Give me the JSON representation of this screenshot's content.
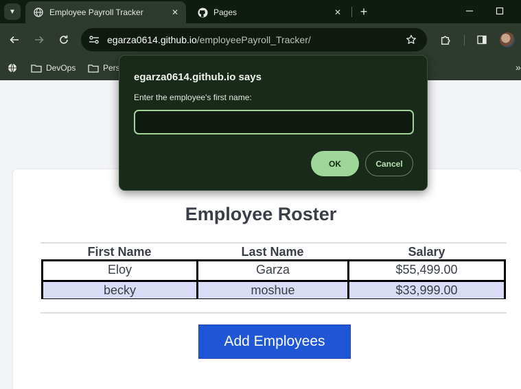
{
  "browser": {
    "tabs": [
      {
        "title": "Employee Payroll Tracker",
        "icon": "globe-icon",
        "active": true
      },
      {
        "title": "Pages",
        "icon": "github-icon",
        "active": false
      }
    ],
    "new_tab": "+",
    "window_controls": {
      "minimize": "—",
      "maximize": "☐",
      "close": "✕"
    },
    "address": {
      "host": "egarza0614.github.io",
      "path": "/employeePayroll_Tracker/"
    },
    "bookmarks": [
      {
        "label": "",
        "icon": "globe-icon"
      },
      {
        "label": "DevOps",
        "icon": "folder-icon"
      },
      {
        "label": "Pers",
        "icon": "folder-icon"
      }
    ],
    "bookmarks_overflow": "»"
  },
  "page": {
    "title": "Employee Roster",
    "columns": [
      "First Name",
      "Last Name",
      "Salary"
    ],
    "rows": [
      {
        "first": "Eloy",
        "last": "Garza",
        "salary": "$55,499.00"
      },
      {
        "first": "becky",
        "last": "moshue",
        "salary": "$33,999.00"
      }
    ],
    "add_button": "Add Employees"
  },
  "dialog": {
    "title": "egarza0614.github.io says",
    "message": "Enter the employee's first name:",
    "input_value": "",
    "ok": "OK",
    "cancel": "Cancel"
  },
  "colors": {
    "browser_frame": "#2d3a2d",
    "tabstrip": "#0f1c0f",
    "dialog_bg": "#1a2a1a",
    "dialog_accent": "#9fd79a",
    "primary_button": "#1f56d6",
    "alt_row": "#d8dcf4"
  }
}
